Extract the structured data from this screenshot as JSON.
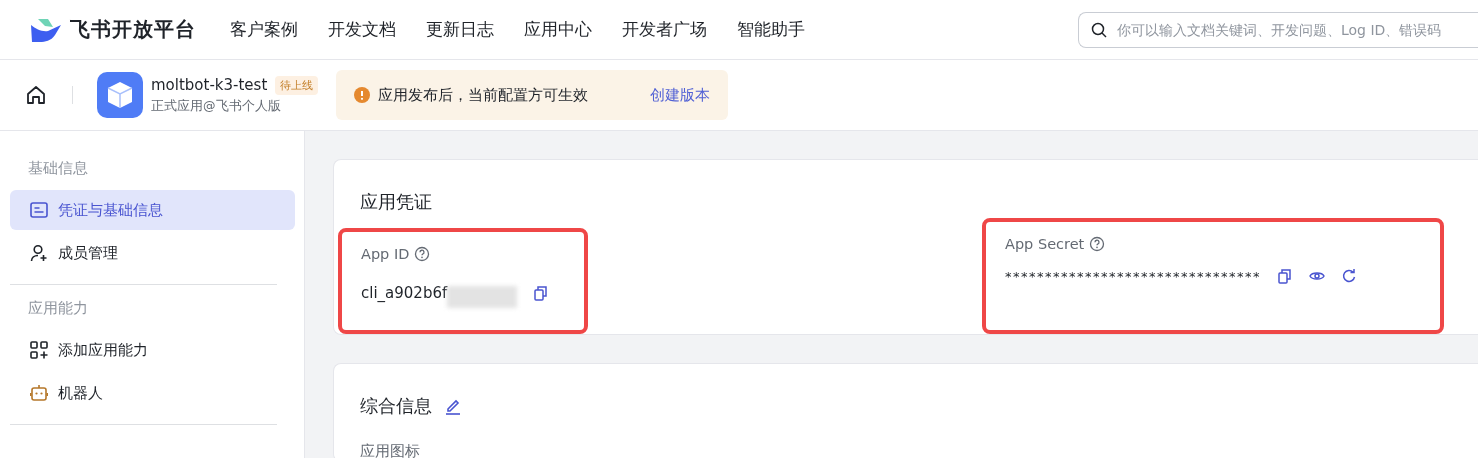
{
  "brand": {
    "name": "飞书开放平台"
  },
  "nav": [
    "客户案例",
    "开发文档",
    "更新日志",
    "应用中心",
    "开发者广场",
    "智能助手"
  ],
  "search": {
    "placeholder": "你可以输入文档关键词、开发问题、Log ID、错误码"
  },
  "app": {
    "name": "moltbot-k3-test",
    "status": "待上线",
    "subtitle": "正式应用@飞书个人版"
  },
  "notice": {
    "text": "应用发布后，当前配置方可生效",
    "link": "创建版本"
  },
  "sidebar": [
    {
      "title": "基础信息",
      "items": [
        {
          "label": "凭证与基础信息",
          "kind": "card",
          "selected": true
        },
        {
          "label": "成员管理",
          "kind": "user-plus",
          "selected": false
        }
      ]
    },
    {
      "title": "应用能力",
      "items": [
        {
          "label": "添加应用能力",
          "kind": "grid-plus",
          "selected": false
        },
        {
          "label": "机器人",
          "kind": "robot",
          "selected": false
        }
      ]
    }
  ],
  "credentials": {
    "title": "应用凭证",
    "fields": [
      {
        "kind": "id",
        "label": "App ID",
        "value": "cli_a902b6f",
        "redacted": true,
        "highlighted": true
      },
      {
        "kind": "secret",
        "label": "App Secret",
        "value": "********************************",
        "redacted": false,
        "highlighted": true
      }
    ]
  },
  "general": {
    "title": "综合信息",
    "first_label": "应用图标"
  }
}
